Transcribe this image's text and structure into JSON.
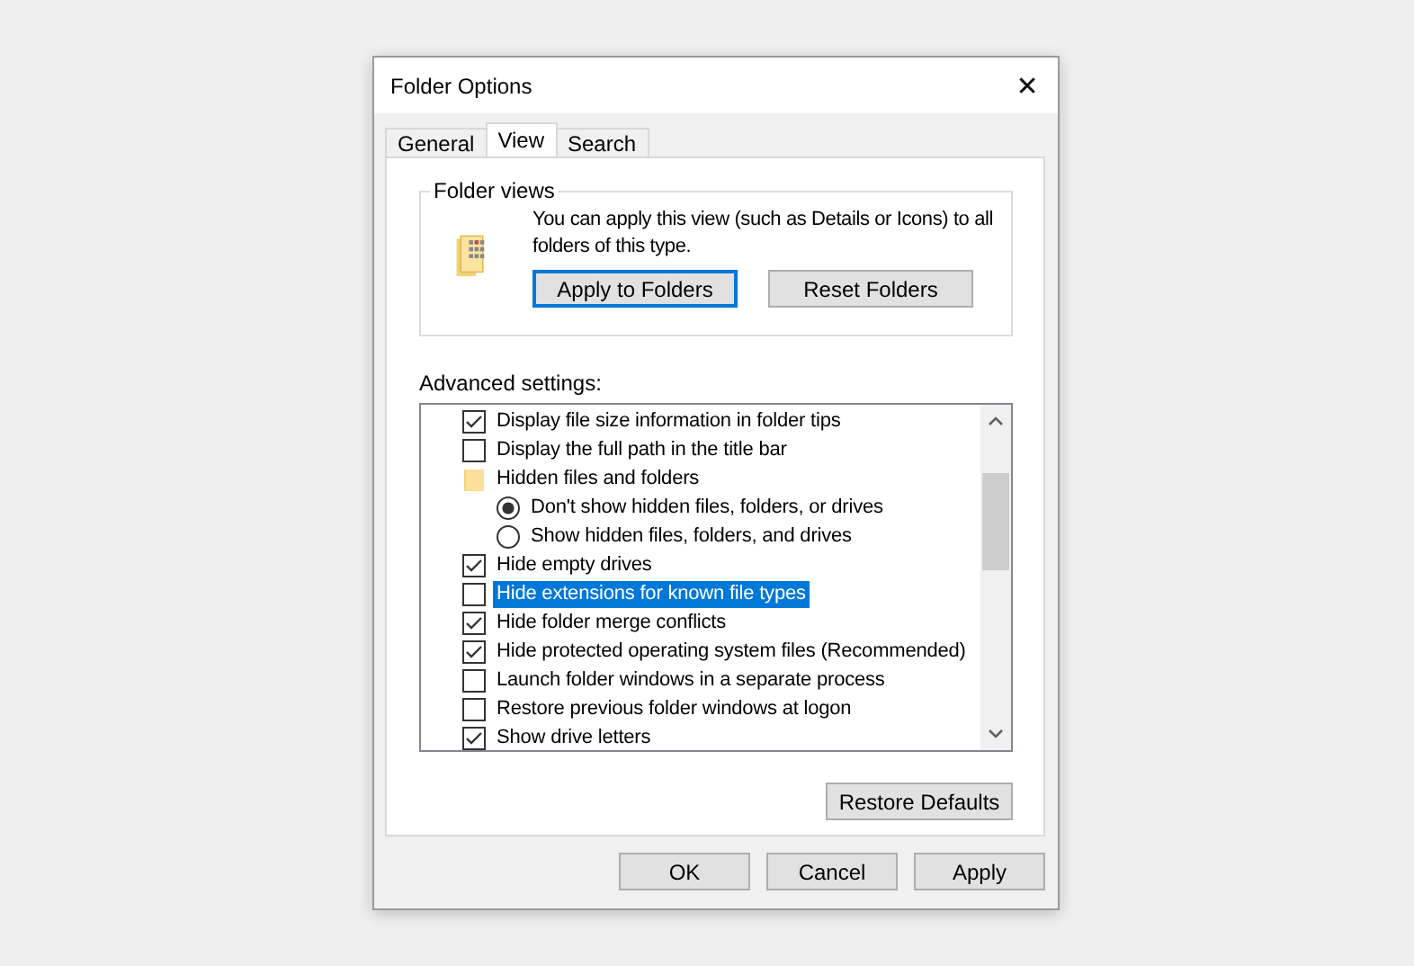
{
  "window": {
    "title": "Folder Options",
    "close": "✕"
  },
  "tabs": [
    {
      "label": "General",
      "selected": false
    },
    {
      "label": "View",
      "selected": true
    },
    {
      "label": "Search",
      "selected": false
    }
  ],
  "folder_views": {
    "title": "Folder views",
    "text": "You can apply this view (such as Details or Icons) to all folders of this type.",
    "buttons": [
      {
        "label": "Apply to Folders",
        "focused": true
      },
      {
        "label": "Reset Folders",
        "focused": false
      }
    ]
  },
  "advanced": {
    "label": "Advanced settings:",
    "items": [
      {
        "kind": "checkbox",
        "label": "Display file size information in folder tips",
        "checked": true,
        "selected": false
      },
      {
        "kind": "checkbox",
        "label": "Display the full path in the title bar",
        "checked": false,
        "selected": false
      },
      {
        "kind": "folder",
        "label": "Hidden files and folders",
        "selected": false,
        "children": [
          {
            "kind": "radio",
            "label": "Don't show hidden files, folders, or drives",
            "checked": true,
            "selected": false
          },
          {
            "kind": "radio",
            "label": "Show hidden files, folders, and drives",
            "checked": false,
            "selected": false
          }
        ]
      },
      {
        "kind": "checkbox",
        "label": "Hide empty drives",
        "checked": true,
        "selected": false
      },
      {
        "kind": "checkbox",
        "label": "Hide extensions for known file types",
        "checked": false,
        "selected": true
      },
      {
        "kind": "checkbox",
        "label": "Hide folder merge conflicts",
        "checked": true,
        "selected": false
      },
      {
        "kind": "checkbox",
        "label": "Hide protected operating system files (Recommended)",
        "checked": true,
        "selected": false
      },
      {
        "kind": "checkbox",
        "label": "Launch folder windows in a separate process",
        "checked": false,
        "selected": false
      },
      {
        "kind": "checkbox",
        "label": "Restore previous folder windows at logon",
        "checked": false,
        "selected": false
      },
      {
        "kind": "checkbox",
        "label": "Show drive letters",
        "checked": true,
        "selected": false
      }
    ]
  },
  "restore_button": "Restore Defaults",
  "buttons": [
    "OK",
    "Cancel",
    "Apply"
  ]
}
